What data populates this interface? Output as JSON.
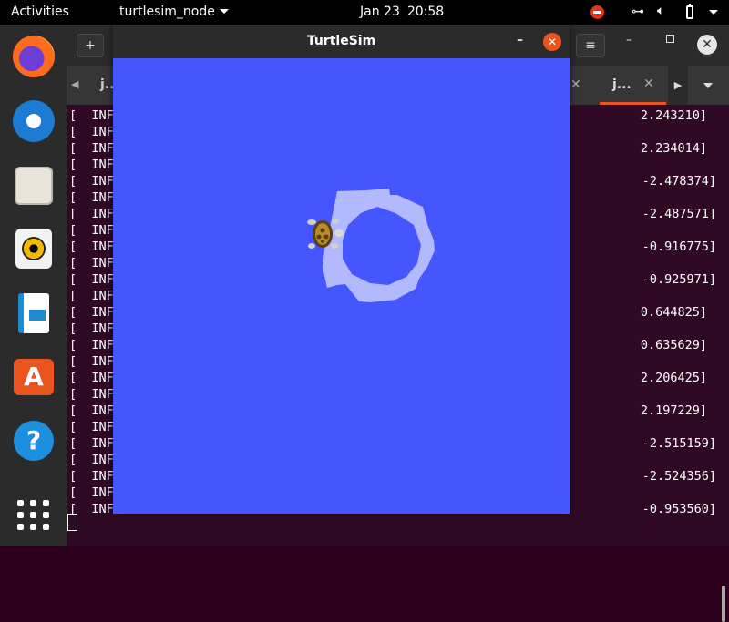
{
  "topbar": {
    "activities": "Activities",
    "app_menu": "turtlesim_node",
    "date": "Jan 23",
    "time": "20:58"
  },
  "dock": {
    "items": [
      "firefox-icon",
      "thunderbird-icon",
      "files-icon",
      "rhythmbox-icon",
      "libreoffice-writer-icon",
      "ubuntu-software-icon",
      "help-icon",
      "show-applications-icon"
    ]
  },
  "terminal": {
    "new_tab": "+",
    "menu": "≡",
    "tab_left": "j...",
    "tab_active": "j...",
    "lines": [
      {
        "prefix": "[  INFO",
        "value": "2.243210]"
      },
      {
        "prefix": "[  INFO",
        "value": ""
      },
      {
        "prefix": "[  INFO",
        "value": "2.234014]"
      },
      {
        "prefix": "[  INFO",
        "value": ""
      },
      {
        "prefix": "[  INFO",
        "value": "-2.478374]"
      },
      {
        "prefix": "[  INFO",
        "value": ""
      },
      {
        "prefix": "[  INFO",
        "value": "-2.487571]"
      },
      {
        "prefix": "[  INFO",
        "value": ""
      },
      {
        "prefix": "[  INFO",
        "value": "-0.916775]"
      },
      {
        "prefix": "[  INFO",
        "value": ""
      },
      {
        "prefix": "[  INFO",
        "value": "-0.925971]"
      },
      {
        "prefix": "[  INFO",
        "value": ""
      },
      {
        "prefix": "[  INFO",
        "value": "0.644825]"
      },
      {
        "prefix": "[  INFO",
        "value": ""
      },
      {
        "prefix": "[  INFO",
        "value": "0.635629]"
      },
      {
        "prefix": "[  INFO",
        "value": ""
      },
      {
        "prefix": "[  INFO",
        "value": "2.206425]"
      },
      {
        "prefix": "[  INFO",
        "value": ""
      },
      {
        "prefix": "[  INFO",
        "value": "2.197229]"
      },
      {
        "prefix": "[  INFO",
        "value": ""
      },
      {
        "prefix": "[  INFO",
        "value": "-2.515159]"
      },
      {
        "prefix": "[  INFO",
        "value": ""
      },
      {
        "prefix": "[  INFO",
        "value": "-2.524356]"
      },
      {
        "prefix": "[  INFO",
        "value": ""
      },
      {
        "prefix": "[  INFO",
        "value": "-0.953560]"
      }
    ]
  },
  "turtlesim": {
    "title": "TurtleSim",
    "background_color": "#4556ff",
    "trail_color": "#b3b9ff"
  }
}
